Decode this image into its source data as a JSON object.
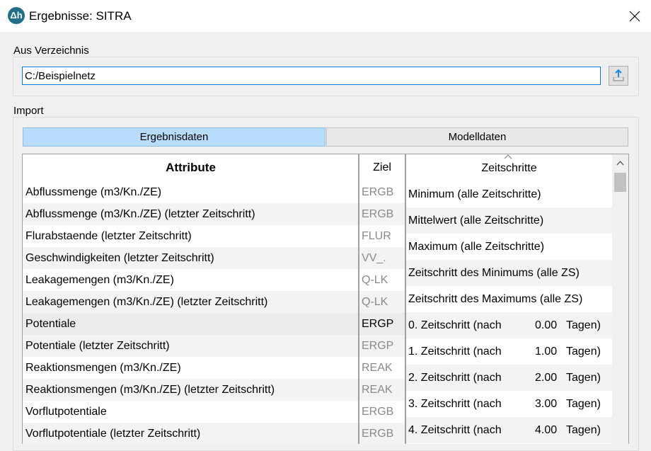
{
  "window": {
    "title": "Ergebnisse: SITRA",
    "icon_text": "Δh"
  },
  "directory": {
    "group_label": "Aus Verzeichnis",
    "path": "C:/Beispielnetz"
  },
  "import": {
    "group_label": "Import",
    "tabs": [
      {
        "label": "Ergebnisdaten",
        "active": true
      },
      {
        "label": "Modelldaten",
        "active": false
      }
    ]
  },
  "attr_table": {
    "header_attr": "Attribute",
    "header_ziel": "Ziel",
    "rows": [
      {
        "attr": "Abflussmenge (m3/Kn./ZE)",
        "ziel": "ERGB"
      },
      {
        "attr": "Abflussmenge (m3/Kn./ZE) (letzter Zeitschritt)",
        "ziel": "ERGB"
      },
      {
        "attr": "Flurabstaende (letzter Zeitschritt)",
        "ziel": "FLUR"
      },
      {
        "attr": "Geschwindigkeiten (letzter Zeitschritt)",
        "ziel": "VV_."
      },
      {
        "attr": "Leakagemengen (m3/Kn./ZE)",
        "ziel": "Q-LK"
      },
      {
        "attr": "Leakagemengen (m3/Kn./ZE) (letzter Zeitschritt)",
        "ziel": "Q-LK"
      },
      {
        "attr": "Potentiale",
        "ziel": "ERGP"
      },
      {
        "attr": "Potentiale (letzter Zeitschritt)",
        "ziel": "ERGP"
      },
      {
        "attr": "Reaktionsmengen (m3/Kn./ZE)",
        "ziel": "REAK"
      },
      {
        "attr": "Reaktionsmengen (m3/Kn./ZE) (letzter Zeitschritt)",
        "ziel": "REAK"
      },
      {
        "attr": "Vorflutpotentiale",
        "ziel": "ERGB"
      },
      {
        "attr": "Vorflutpotentiale (letzter Zeitschritt)",
        "ziel": "ERGB"
      }
    ]
  },
  "zeit_table": {
    "header": "Zeitschritte",
    "rows": [
      {
        "label": "Minimum (alle Zeitschritte)"
      },
      {
        "label": "Mittelwert (alle Zeitschritte)"
      },
      {
        "label": "Maximum (alle Zeitschritte)"
      },
      {
        "label": "Zeitschritt des Minimums (alle ZS)"
      },
      {
        "label": "Zeitschritt des Maximums (alle ZS)"
      },
      {
        "label": "0. Zeitschritt (nach",
        "value": "0.00",
        "unit": "Tagen)"
      },
      {
        "label": "1. Zeitschritt (nach",
        "value": "1.00",
        "unit": "Tagen)"
      },
      {
        "label": "2. Zeitschritt (nach",
        "value": "2.00",
        "unit": "Tagen)"
      },
      {
        "label": "3. Zeitschritt (nach",
        "value": "3.00",
        "unit": "Tagen)"
      },
      {
        "label": "4. Zeitschritt (nach",
        "value": "4.00",
        "unit": "Tagen)"
      }
    ]
  },
  "colors": {
    "tab_active": "#b8dcfb",
    "input_focus_border": "#0078d7",
    "icon_bg": "#1f6f8b"
  }
}
